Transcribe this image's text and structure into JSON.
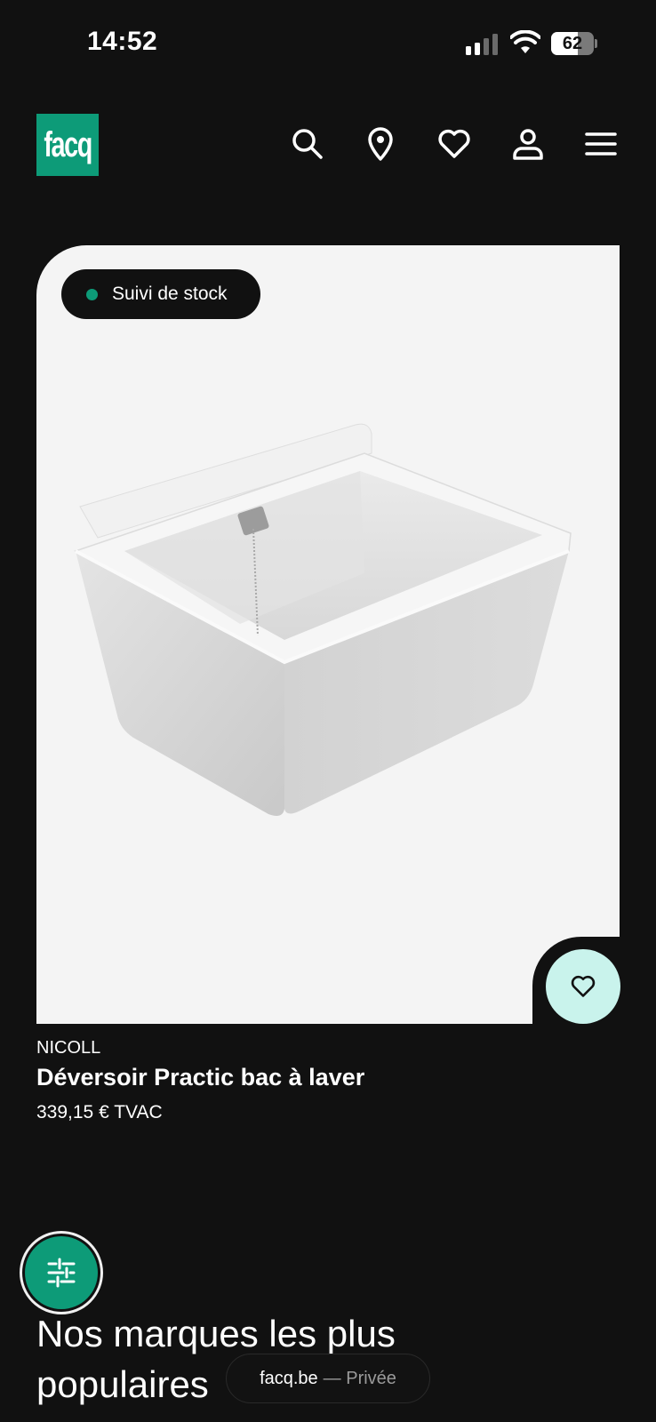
{
  "status_bar": {
    "time": "14:52",
    "battery": "62",
    "battery_level": 0.62
  },
  "header": {
    "logo_text": "facq",
    "icons": [
      "search-icon",
      "location-pin-icon",
      "heart-icon",
      "user-icon",
      "menu-icon"
    ]
  },
  "product": {
    "badge": "Suivi de stock",
    "brand": "NICOLL",
    "name": "Déversoir Practic bac à laver",
    "price": "339,15 € TVAC"
  },
  "section": {
    "title": "Nos marques les plus populaires"
  },
  "browser": {
    "domain": "facq.be",
    "mode": "— Privée"
  },
  "colors": {
    "accent": "#0d9b78",
    "favorite_bg": "#c9f3ec",
    "background": "#111111"
  }
}
